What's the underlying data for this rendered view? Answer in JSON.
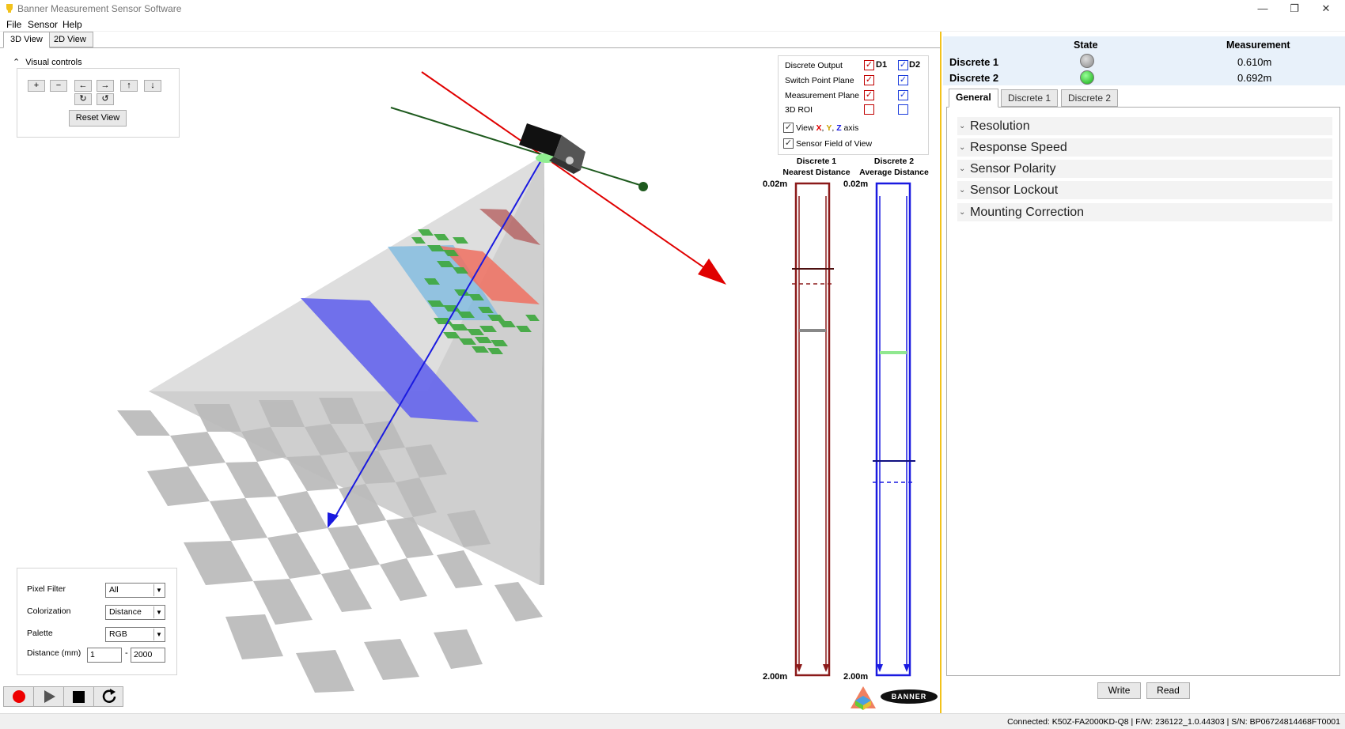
{
  "window": {
    "title": "Banner Measurement Sensor Software",
    "minimize": "—",
    "restore": "❐",
    "close": "✕"
  },
  "menu": [
    "File",
    "Sensor",
    "Help"
  ],
  "view_tabs": [
    "3D View",
    "2D View"
  ],
  "visual_controls": {
    "header": "Visual controls",
    "reset_label": "Reset View"
  },
  "overlay": {
    "col_d1": "D1",
    "col_d2": "D2",
    "rows": [
      {
        "label": "Discrete Output",
        "d1": true,
        "d2": true
      },
      {
        "label": "Switch Point Plane",
        "d1": true,
        "d2": true
      },
      {
        "label": "Measurement Plane",
        "d1": true,
        "d2": true
      },
      {
        "label": "3D ROI",
        "d1": false,
        "d2": false
      }
    ],
    "view_axis_prefix": "View ",
    "axis_x": "X",
    "axis_y": "Y",
    "axis_z": "Z",
    "axis_suffix": " axis",
    "view_axis_checked": true,
    "fov_label": "Sensor Field of View",
    "fov_checked": true,
    "colors": {
      "x": "#e00000",
      "y": "#c8a000",
      "z": "#1a1ae0"
    }
  },
  "gauges": [
    {
      "title1": "Discrete 1",
      "title2": "Nearest Distance",
      "top": "0.02m",
      "bottom": "2.00m",
      "color": "#8b1a1a",
      "marker_color": "#888888"
    },
    {
      "title1": "Discrete 2",
      "title2": "Average Distance",
      "top": "0.02m",
      "bottom": "2.00m",
      "color": "#1a1ae0",
      "marker_color": "#90e890"
    }
  ],
  "brand": "BANNER",
  "filters": {
    "pixel_filter_label": "Pixel Filter",
    "pixel_filter_value": "All",
    "colorization_label": "Colorization",
    "colorization_value": "Distance",
    "palette_label": "Palette",
    "palette_value": "RGB",
    "distance_label": "Distance (mm)",
    "distance_min": "1",
    "distance_sep": "-",
    "distance_max": "2000"
  },
  "state_panel": {
    "state_header": "State",
    "measurement_header": "Measurement",
    "rows": [
      {
        "label": "Discrete 1",
        "value": "0.610m",
        "led": "#9a9a9a"
      },
      {
        "label": "Discrete 2",
        "value": "0.692m",
        "led": "#22cc22"
      }
    ]
  },
  "right_tabs": [
    "General",
    "Discrete 1",
    "Discrete 2"
  ],
  "sections": [
    "Resolution",
    "Response Speed",
    "Sensor Polarity",
    "Sensor Lockout",
    "Mounting Correction"
  ],
  "actions": {
    "write": "Write",
    "read": "Read"
  },
  "status": "Connected: K50Z-FA2000KD-Q8 | F/W: 236122_1.0.44303 | S/N: BP06724814468FT0001"
}
